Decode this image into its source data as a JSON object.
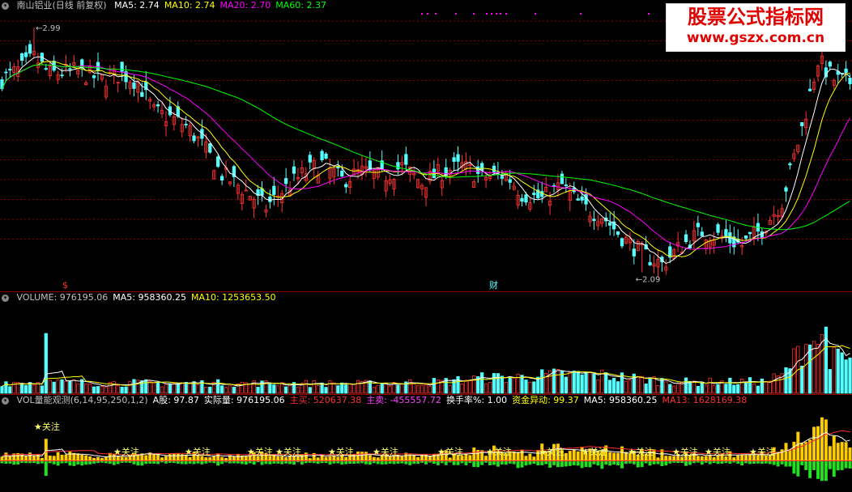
{
  "stock": {
    "name": "南山铝业(日线 前复权)"
  },
  "price_header": [
    {
      "label": "MA5: 2.74",
      "color": "#ffffff"
    },
    {
      "label": "MA10: 2.74",
      "color": "#ffff00"
    },
    {
      "label": "MA20: 2.70",
      "color": "#ff00ff"
    },
    {
      "label": "MA60: 2.37",
      "color": "#00ff00"
    }
  ],
  "volume_header": [
    {
      "label": "VOLUME: 976195.06",
      "color": "#c0c0c0"
    },
    {
      "label": "MA5: 958360.25",
      "color": "#ffffff"
    },
    {
      "label": "MA10: 1253653.50",
      "color": "#ffff00"
    }
  ],
  "indicator_header": [
    {
      "label": "VOL量能观测(6,14,95,250,1,2)",
      "color": "#c0c0c0"
    },
    {
      "label": "A股: 97.87",
      "color": "#ffffff"
    },
    {
      "label": "实际量: 976195.06",
      "color": "#ffffff"
    },
    {
      "label": "主买: 520637.38",
      "color": "#ff3030"
    },
    {
      "label": "主卖: -455557.72",
      "color": "#ff40ff"
    },
    {
      "label": "换手率%: 1.00",
      "color": "#ffffff"
    },
    {
      "label": "资金异动: 99.37",
      "color": "#ffff00"
    },
    {
      "label": "MA5: 958360.25",
      "color": "#ffffff"
    },
    {
      "label": "MA13: 1628169.38",
      "color": "#ff3030"
    }
  ],
  "annotations": {
    "high": "2.99",
    "low": "2.09",
    "marker_s": "$",
    "marker_cai": "财",
    "star_label": "关注"
  },
  "watermark": {
    "line1": "股票公式指标网",
    "line2": "www.gszx.com.cn"
  },
  "colors": {
    "up": "#ff3232",
    "down": "#54ffff",
    "ma5": "#ffffff",
    "ma10": "#ffff00",
    "ma20": "#ff00ff",
    "ma60": "#00ff00",
    "grid": "#8b0000"
  },
  "chart_data": {
    "type": "candlestick",
    "price_ylim": [
      2.05,
      3.05
    ],
    "close_keypoints": [
      [
        0,
        2.8
      ],
      [
        5,
        2.84
      ],
      [
        8,
        2.88
      ],
      [
        12,
        2.82
      ],
      [
        18,
        2.83
      ],
      [
        25,
        2.8
      ],
      [
        30,
        2.82
      ],
      [
        34,
        2.79
      ],
      [
        38,
        2.68
      ],
      [
        42,
        2.66
      ],
      [
        46,
        2.63
      ],
      [
        50,
        2.56
      ],
      [
        55,
        2.45
      ],
      [
        60,
        2.4
      ],
      [
        66,
        2.33
      ],
      [
        70,
        2.39
      ],
      [
        76,
        2.46
      ],
      [
        80,
        2.49
      ],
      [
        85,
        2.43
      ],
      [
        90,
        2.46
      ],
      [
        95,
        2.44
      ],
      [
        100,
        2.48
      ],
      [
        105,
        2.42
      ],
      [
        110,
        2.46
      ],
      [
        115,
        2.48
      ],
      [
        120,
        2.44
      ],
      [
        126,
        2.45
      ],
      [
        130,
        2.38
      ],
      [
        135,
        2.36
      ],
      [
        140,
        2.41
      ],
      [
        145,
        2.33
      ],
      [
        150,
        2.3
      ],
      [
        155,
        2.22
      ],
      [
        160,
        2.16
      ],
      [
        165,
        2.12
      ],
      [
        170,
        2.19
      ],
      [
        175,
        2.24
      ],
      [
        180,
        2.22
      ],
      [
        185,
        2.19
      ],
      [
        190,
        2.25
      ],
      [
        195,
        2.35
      ],
      [
        200,
        2.62
      ],
      [
        204,
        2.87
      ],
      [
        208,
        2.8
      ],
      [
        212,
        2.79
      ]
    ],
    "high_label": {
      "index": 8,
      "value": 2.99
    },
    "low_label": {
      "index": 160,
      "value": 2.09
    },
    "volume_ylim": [
      0,
      2600000
    ],
    "volume_levels": [
      [
        0,
        330000
      ],
      [
        30,
        300000
      ],
      [
        60,
        290000
      ],
      [
        90,
        280000
      ],
      [
        110,
        340000
      ],
      [
        120,
        450000
      ],
      [
        130,
        480000
      ],
      [
        140,
        560000
      ],
      [
        150,
        530000
      ],
      [
        160,
        420000
      ],
      [
        170,
        330000
      ],
      [
        180,
        330000
      ],
      [
        190,
        340000
      ],
      [
        195,
        500000
      ],
      [
        200,
        1350000
      ],
      [
        204,
        1650000
      ],
      [
        208,
        1000000
      ],
      [
        212,
        980000
      ]
    ],
    "bars": 213
  }
}
